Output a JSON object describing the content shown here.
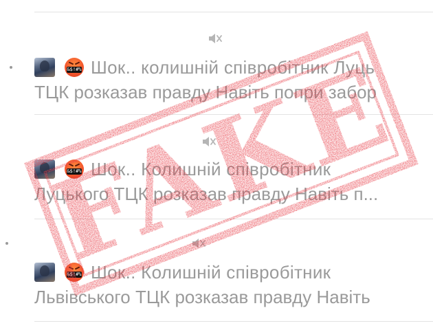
{
  "stamp": {
    "text": "FAKE",
    "color": "#e8404a"
  },
  "items": [
    {
      "emoji_text": "&$!#%",
      "line1": "Шок.. колишній співробітник Луць",
      "line2": "ТЦК розказав правду Навіть попри забор"
    },
    {
      "emoji_text": "&$!#%",
      "line1": "Шок.. Колишній співробітник",
      "line2": "Луцького ТЦК розказав правду Навіть п..."
    },
    {
      "emoji_text": "&$!#%",
      "line1": "Шок.. Колишній співробітник",
      "line2": "Львівського ТЦК розказав правду Навіть"
    }
  ],
  "icons": {
    "mute": "muted-speaker-icon",
    "thumb": "channel-avatar",
    "emoji": "angry-cursing-face-icon"
  }
}
